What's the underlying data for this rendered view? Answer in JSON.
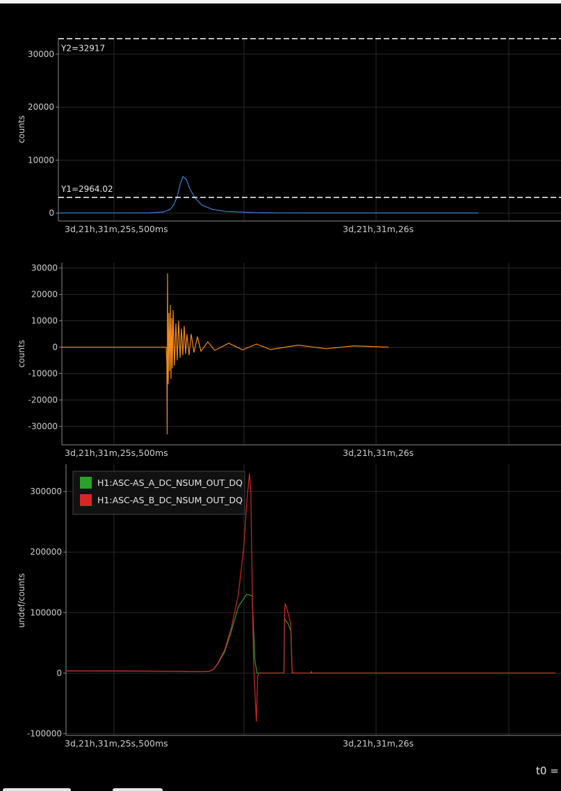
{
  "footer": {
    "t0_text": "t0 = "
  },
  "colors": {
    "background": "#000000",
    "grid": "#2a2a2a",
    "axis": "#8a8a8a",
    "text": "#cfcfcf",
    "series_blue": "#3b82d6",
    "series_orange": "#f28a1e",
    "series_green": "#2ca02c",
    "series_red": "#d62728",
    "cursor": "#ffffff"
  },
  "chart_data": [
    {
      "type": "line",
      "ylabel": "counts",
      "xlabel": "",
      "ylim": [
        -1500,
        33000
      ],
      "yticks": [
        0,
        10000,
        20000,
        30000
      ],
      "xtick_labels": [
        "3d,21h,31m,25s,500ms",
        "3d,21h,31m,26s"
      ],
      "cursors": [
        {
          "label": "Y2=32917",
          "value": 32917
        },
        {
          "label": "Y1=2964.02",
          "value": 2964.02
        }
      ],
      "series": [
        {
          "color": "#3b82d6",
          "x": [
            0,
            50,
            100,
            130,
            150,
            160,
            165,
            170,
            174,
            178,
            183,
            188,
            195,
            205,
            220,
            240,
            280,
            320,
            360,
            400,
            600
          ],
          "values": [
            30,
            30,
            30,
            60,
            200,
            700,
            1600,
            3200,
            5500,
            6900,
            6300,
            4500,
            2900,
            1500,
            700,
            300,
            100,
            40,
            20,
            20,
            20
          ]
        }
      ]
    },
    {
      "type": "line",
      "ylabel": "counts",
      "xlabel": "",
      "ylim": [
        -37000,
        32000
      ],
      "yticks": [
        -30000,
        -20000,
        -10000,
        0,
        10000,
        20000,
        30000
      ],
      "xtick_labels": [
        "3d,21h,31m,25s,500ms",
        "3d,21h,31m,26s"
      ],
      "series": [
        {
          "color": "#f28a1e",
          "x": [
            0,
            150,
            151,
            151.5,
            152,
            153,
            154,
            155,
            156,
            157,
            158,
            159,
            160,
            162,
            164,
            166,
            168,
            170,
            172,
            174,
            176,
            178,
            180,
            183,
            186,
            190,
            195,
            200,
            210,
            220,
            240,
            260,
            280,
            300,
            340,
            380,
            420,
            470
          ],
          "values": [
            0,
            0,
            -6000,
            -33000,
            28000,
            -14000,
            13000,
            -9000,
            16000,
            -12000,
            11000,
            -8000,
            14000,
            -7000,
            9000,
            -5000,
            10000,
            -4000,
            7000,
            -3000,
            8000,
            -2500,
            5000,
            -3000,
            5000,
            -2000,
            4000,
            -1500,
            2000,
            -1200,
            1500,
            -1000,
            1200,
            -900,
            800,
            -600,
            500,
            0
          ]
        }
      ]
    },
    {
      "type": "line",
      "ylabel": "undef/counts",
      "xlabel": "",
      "ylim": [
        -103000,
        345000
      ],
      "yticks": [
        -100000,
        0,
        100000,
        200000,
        300000
      ],
      "xtick_labels": [
        "3d,21h,31m,25s,500ms",
        "3d,21h,31m,26s"
      ],
      "legend": {
        "placement": "top-left"
      },
      "series": [
        {
          "name": "H1:ASC-AS_A_DC_NSUM_OUT_DQ",
          "color": "#2ca02c",
          "x": [
            0,
            100,
            150,
            170,
            190,
            200,
            208,
            214,
            220,
            230,
            240,
            250,
            262,
            270,
            274,
            277,
            278,
            279,
            280,
            300,
            316,
            317,
            318,
            322,
            326,
            328,
            329,
            330,
            400,
            710
          ],
          "values": [
            3500,
            3300,
            3000,
            2700,
            2500,
            2600,
            3000,
            6000,
            15000,
            35000,
            70000,
            110000,
            130000,
            128000,
            20000,
            0,
            0,
            0,
            0,
            0,
            0,
            90000,
            88000,
            82000,
            70000,
            0,
            0,
            0,
            0,
            0
          ]
        },
        {
          "name": "H1:ASC-AS_B_DC_NSUM_OUT_DQ",
          "color": "#d62728",
          "x": [
            0,
            100,
            150,
            170,
            190,
            200,
            208,
            214,
            220,
            230,
            240,
            250,
            258,
            262,
            266,
            268,
            270,
            272,
            274,
            276,
            278,
            280,
            300,
            316,
            317,
            318,
            322,
            326,
            328,
            329,
            330,
            355,
            356,
            357,
            400,
            710
          ],
          "values": [
            3600,
            3400,
            3100,
            2800,
            2600,
            2700,
            3100,
            6500,
            16000,
            38000,
            76000,
            130000,
            210000,
            280000,
            330000,
            300000,
            150000,
            20000,
            -30000,
            -80000,
            -5000,
            0,
            0,
            0,
            105000,
            115000,
            100000,
            80000,
            2000,
            0,
            0,
            0,
            2500,
            0,
            0,
            0
          ]
        }
      ]
    }
  ]
}
